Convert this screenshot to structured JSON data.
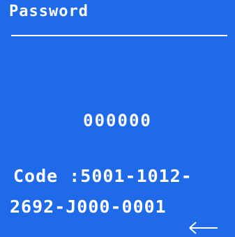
{
  "screen": {
    "title": "Password",
    "password_value": "000000",
    "code_line_1": "Code :5001-1012-",
    "code_line_2": "2692-J000-0001",
    "back_icon": "left-arrow-icon",
    "background_color": "#1f6ae8",
    "text_color": "#ffffff"
  }
}
